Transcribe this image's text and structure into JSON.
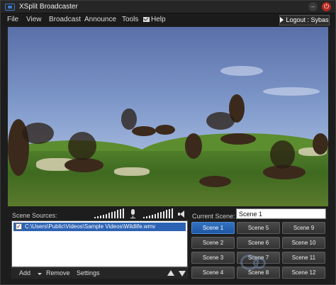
{
  "window": {
    "title": "XSplit Broadcaster",
    "minimize_glyph": "–",
    "close_glyph": "⏻"
  },
  "menu": {
    "items": [
      "File",
      "View",
      "Broadcast",
      "Announce",
      "Tools",
      "Help"
    ],
    "help_icon": "mail-icon",
    "logout_label": "Logout : Sybas"
  },
  "sources": {
    "label": "Scene Sources:",
    "items": [
      {
        "checked": true,
        "check_glyph": "✓",
        "path": "C:\\Users\\Public\\Videos\\Sample Videos\\Wildlife.wmv"
      }
    ],
    "toolbar": {
      "add_label": "Add",
      "remove_label": "Remove",
      "settings_label": "Settings"
    }
  },
  "audio": {
    "mic_icon": "microphone-icon",
    "speaker_icon": "speaker-icon"
  },
  "scenes": {
    "current_label": "Current Scene:",
    "current_value": "Scene 1",
    "buttons": [
      "Scene 1",
      "Scene 5",
      "Scene 9",
      "Scene 2",
      "Scene 6",
      "Scene 10",
      "Scene 3",
      "Scene 7",
      "Scene 11",
      "Scene 4",
      "Scene 8",
      "Scene 12"
    ],
    "active": "Scene 1"
  },
  "colors": {
    "accent": "#2c62b3",
    "close_red": "#b3281e"
  }
}
